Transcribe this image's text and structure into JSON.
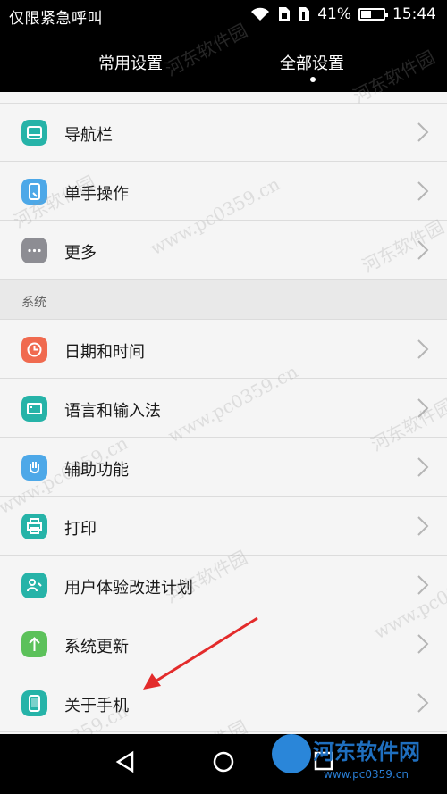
{
  "status": {
    "carrier": "仅限紧急呼叫",
    "battery": "41%",
    "battery_level": 0.41,
    "time": "15:44"
  },
  "tabs": {
    "common": "常用设置",
    "all": "全部设置",
    "active": "all"
  },
  "rows_top": [
    {
      "label": "导航栏",
      "icon": "navbar-icon",
      "color": "#26b3a8"
    },
    {
      "label": "单手操作",
      "icon": "one-hand-icon",
      "color": "#4da8e8"
    },
    {
      "label": "更多",
      "icon": "more-dots-icon",
      "color": "#8d8d93"
    }
  ],
  "section": {
    "title": "系统"
  },
  "rows_system": [
    {
      "label": "日期和时间",
      "icon": "clock-icon",
      "color": "#f06a4f"
    },
    {
      "label": "语言和输入法",
      "icon": "keyboard-icon",
      "color": "#26b3a8"
    },
    {
      "label": "辅助功能",
      "icon": "hand-icon",
      "color": "#4da8e8"
    },
    {
      "label": "打印",
      "icon": "printer-icon",
      "color": "#26b3a8"
    },
    {
      "label": "用户体验改进计划",
      "icon": "user-experience-icon",
      "color": "#26b3a8"
    },
    {
      "label": "系统更新",
      "icon": "update-arrow-icon",
      "color": "#5cc15a"
    },
    {
      "label": "关于手机",
      "icon": "phone-icon",
      "color": "#26b3a8"
    }
  ],
  "watermark": {
    "text1": "河东软件园",
    "text2": "www.pc0359.cn"
  },
  "logo": {
    "name": "河东软件网",
    "url": "www.pc0359.cn"
  }
}
